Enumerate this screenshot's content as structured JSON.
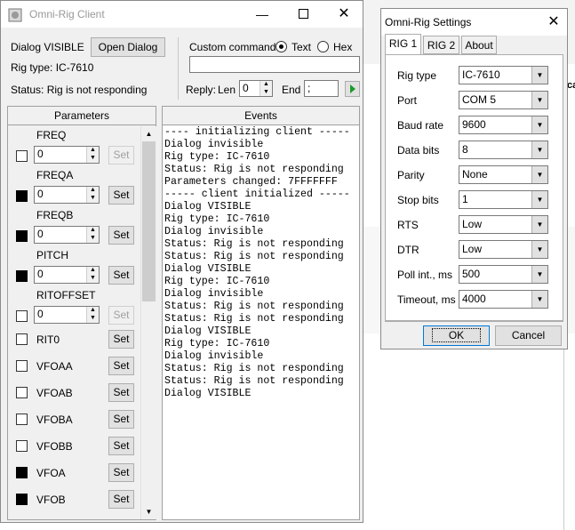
{
  "client": {
    "title": "Omni-Rig Client",
    "dialog_status": "Dialog VISIBLE",
    "open_dialog_label": "Open Dialog",
    "rig_type": "Rig type: IC-7610",
    "status": "Status: Rig is not responding",
    "custom_command_label": "Custom command",
    "text_label": "Text",
    "hex_label": "Hex",
    "custom_command_value": "",
    "reply_label": "Reply:",
    "len_label": "Len",
    "len_value": "0",
    "end_label": "End",
    "end_value": ";",
    "parameters_header": "Parameters",
    "events_header": "Events",
    "set_label": "Set",
    "params_with_value": [
      {
        "name": "FREQ",
        "value": "0",
        "checked": false,
        "set_enabled": false
      },
      {
        "name": "FREQA",
        "value": "0",
        "checked": true,
        "set_enabled": true
      },
      {
        "name": "FREQB",
        "value": "0",
        "checked": true,
        "set_enabled": true
      },
      {
        "name": "PITCH",
        "value": "0",
        "checked": true,
        "set_enabled": true
      },
      {
        "name": "RITOFFSET",
        "value": "0",
        "checked": false,
        "set_enabled": false
      }
    ],
    "params_simple": [
      {
        "name": "RIT0",
        "checked": false
      },
      {
        "name": "VFOAA",
        "checked": false
      },
      {
        "name": "VFOAB",
        "checked": false
      },
      {
        "name": "VFOBA",
        "checked": false
      },
      {
        "name": "VFOBB",
        "checked": false
      },
      {
        "name": "VFOA",
        "checked": true
      },
      {
        "name": "VFOB",
        "checked": true
      }
    ],
    "events": [
      "---- initializing client -----",
      "Dialog invisible",
      "Rig type: IC-7610",
      "Status: Rig is not responding",
      "Parameters changed: 7FFFFFFF",
      "----- client initialized -----",
      "Dialog VISIBLE",
      "Rig type: IC-7610",
      "Dialog invisible",
      "Status: Rig is not responding",
      "Status: Rig is not responding",
      "Dialog VISIBLE",
      "Rig type: IC-7610",
      "Dialog invisible",
      "Status: Rig is not responding",
      "Status: Rig is not responding",
      "Dialog VISIBLE",
      "Rig type: IC-7610",
      "Dialog invisible",
      "Status: Rig is not responding",
      "Status: Rig is not responding",
      "Dialog VISIBLE"
    ]
  },
  "settings": {
    "title": "Omni-Rig Settings",
    "tabs": [
      "RIG 1",
      "RIG 2",
      "About"
    ],
    "fields": [
      {
        "label": "Rig type",
        "value": "IC-7610"
      },
      {
        "label": "Port",
        "value": "COM 5"
      },
      {
        "label": "Baud rate",
        "value": "9600"
      },
      {
        "label": "Data bits",
        "value": "8"
      },
      {
        "label": "Parity",
        "value": "None"
      },
      {
        "label": "Stop bits",
        "value": "1"
      },
      {
        "label": "RTS",
        "value": "Low"
      },
      {
        "label": "DTR",
        "value": "Low"
      },
      {
        "label": "Poll int., ms",
        "value": "500"
      },
      {
        "label": "Timeout, ms",
        "value": "4000"
      }
    ],
    "ok_label": "OK",
    "cancel_label": "Cancel"
  },
  "background": {
    "edge_text": "ca"
  }
}
